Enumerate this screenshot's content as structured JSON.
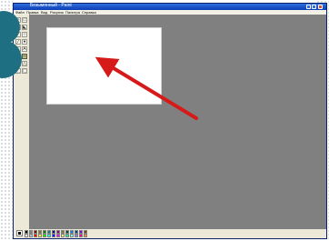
{
  "window": {
    "title": "Безымянный - Paint"
  },
  "menu": {
    "items": [
      "Файл",
      "Правка",
      "Вид",
      "Рисунок",
      "Палитра",
      "Справка"
    ]
  },
  "toolbox": {
    "tools": [
      {
        "icon": "free-select-icon",
        "glyph": "✧"
      },
      {
        "icon": "rect-select-icon",
        "glyph": "▭"
      },
      {
        "icon": "eraser-icon",
        "glyph": "▮"
      },
      {
        "icon": "fill-icon",
        "glyph": "◣"
      },
      {
        "icon": "picker-icon",
        "glyph": "╱"
      },
      {
        "icon": "magnifier-icon",
        "glyph": "○"
      },
      {
        "icon": "pencil-icon",
        "glyph": "╱"
      },
      {
        "icon": "brush-icon",
        "glyph": "♦"
      },
      {
        "icon": "airbrush-icon",
        "glyph": "∴"
      },
      {
        "icon": "text-icon",
        "glyph": "A"
      },
      {
        "icon": "line-icon",
        "glyph": "╲"
      },
      {
        "icon": "curve-icon",
        "glyph": "∼"
      },
      {
        "icon": "rectangle-icon",
        "glyph": "□"
      },
      {
        "icon": "polygon-icon",
        "glyph": "△"
      },
      {
        "icon": "ellipse-icon",
        "glyph": "◯"
      },
      {
        "icon": "rounded-rect-icon",
        "glyph": "▢"
      }
    ]
  },
  "palette": {
    "colors": [
      "#000000",
      "#808080",
      "#800000",
      "#808000",
      "#008000",
      "#008080",
      "#000080",
      "#800080",
      "#808040",
      "#004040",
      "#0080ff",
      "#004080",
      "#8000ff",
      "#804000",
      "#ffffff",
      "#c0c0c0",
      "#ff0000",
      "#ffff00",
      "#00ff00",
      "#00ffff",
      "#0000ff",
      "#ff00ff",
      "#ffff80",
      "#00ff80",
      "#80ffff",
      "#8080ff",
      "#ff0080",
      "#ff8040"
    ]
  },
  "colors": {
    "accent_circle": "#1f6f82",
    "workspace": "#808080",
    "arrow": "#d61a1a"
  }
}
